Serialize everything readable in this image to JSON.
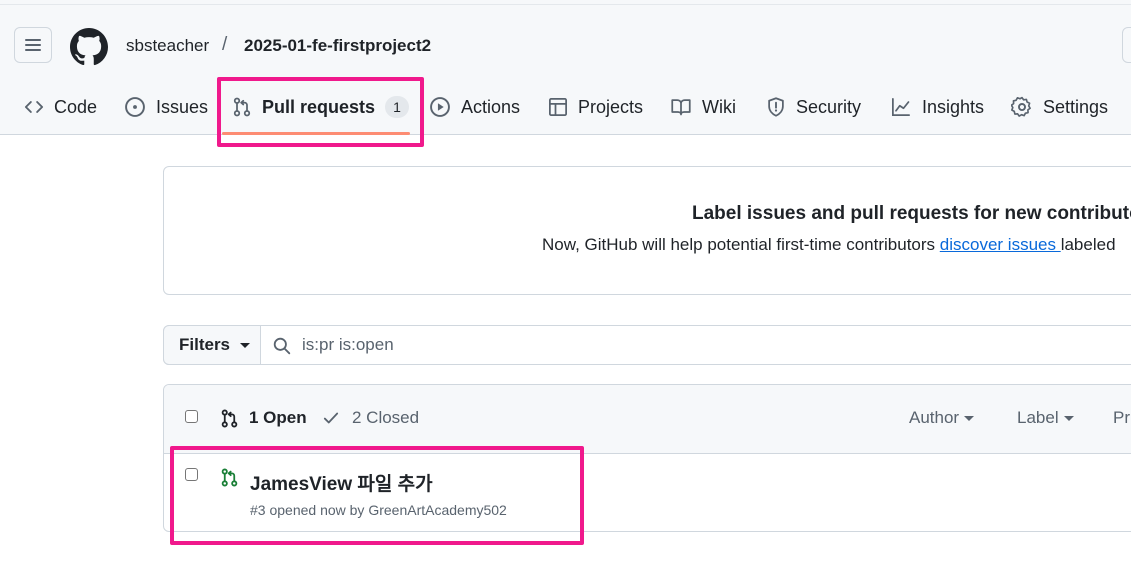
{
  "header": {
    "owner": "sbsteacher",
    "separator": "/",
    "repo": "2025-01-fe-firstproject2"
  },
  "nav": {
    "tabs": [
      {
        "label": "Code",
        "icon": "code-icon"
      },
      {
        "label": "Issues",
        "icon": "issue-opened-icon"
      },
      {
        "label": "Pull requests",
        "icon": "git-pull-request-icon",
        "counter": "1",
        "selected": true
      },
      {
        "label": "Actions",
        "icon": "play-icon"
      },
      {
        "label": "Projects",
        "icon": "table-icon"
      },
      {
        "label": "Wiki",
        "icon": "book-icon"
      },
      {
        "label": "Security",
        "icon": "shield-icon"
      },
      {
        "label": "Insights",
        "icon": "graph-icon"
      },
      {
        "label": "Settings",
        "icon": "gear-icon"
      }
    ]
  },
  "banner": {
    "title": "Label issues and pull requests for new contributo",
    "text_prefix": "Now, GitHub will help potential first-time contributors ",
    "link": "discover issues ",
    "text_suffix": "labeled"
  },
  "filter": {
    "button_label": "Filters",
    "query": "is:pr is:open"
  },
  "list": {
    "open_label": "1 Open",
    "closed_label": "2 Closed",
    "dropdowns": [
      "Author",
      "Label",
      "Pr"
    ],
    "items": [
      {
        "title": "JamesView 파일 추가",
        "meta": "#3 opened now by GreenArtAcademy502"
      }
    ]
  },
  "colors": {
    "highlight": "#f0198c",
    "tab_underline": "#fd8c73",
    "open_green": "#1a7f37",
    "link": "#0969da"
  }
}
